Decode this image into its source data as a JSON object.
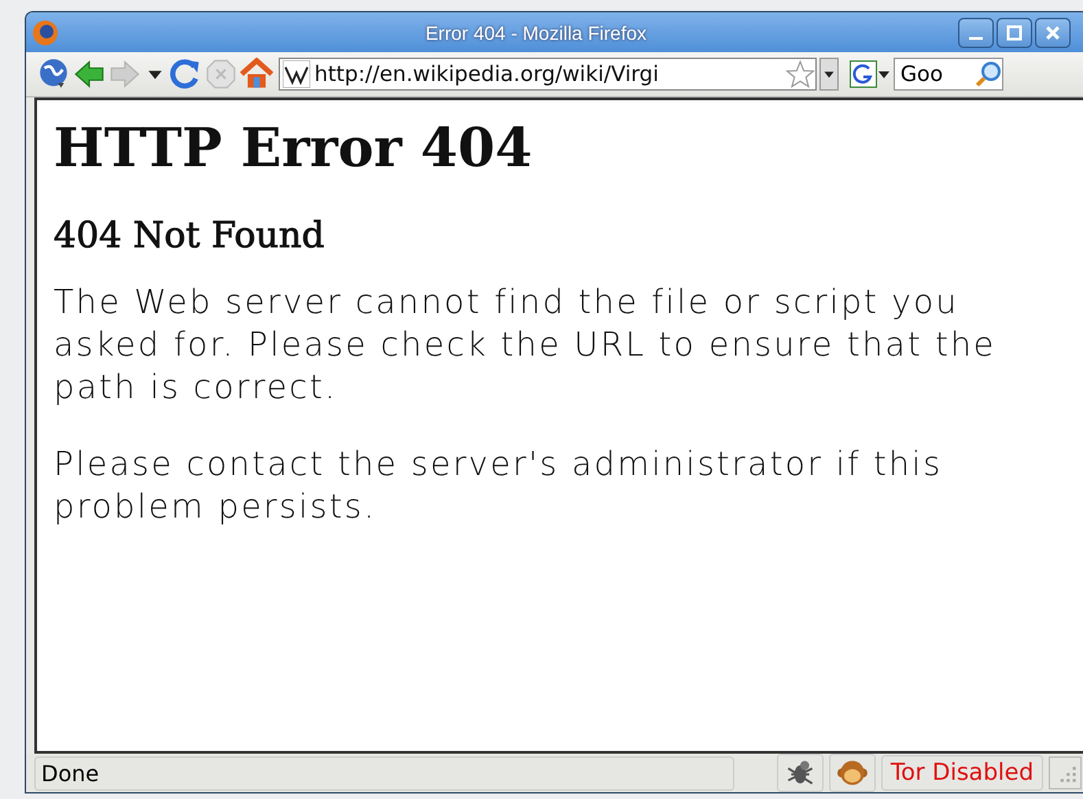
{
  "window": {
    "title": "Error 404 - Mozilla Firefox"
  },
  "toolbar": {
    "url": "http://en.wikipedia.org/wiki/Virgi",
    "search": "Goo"
  },
  "page": {
    "heading": "HTTP Error 404",
    "subheading": "404 Not Found",
    "paragraphs": [
      "The Web server cannot find the file or script you asked for. Please check the URL to ensure that the path is correct.",
      "Please contact the server's administrator if this problem persists."
    ]
  },
  "status_bar": {
    "text": "Done",
    "tor": "Tor Disabled"
  }
}
